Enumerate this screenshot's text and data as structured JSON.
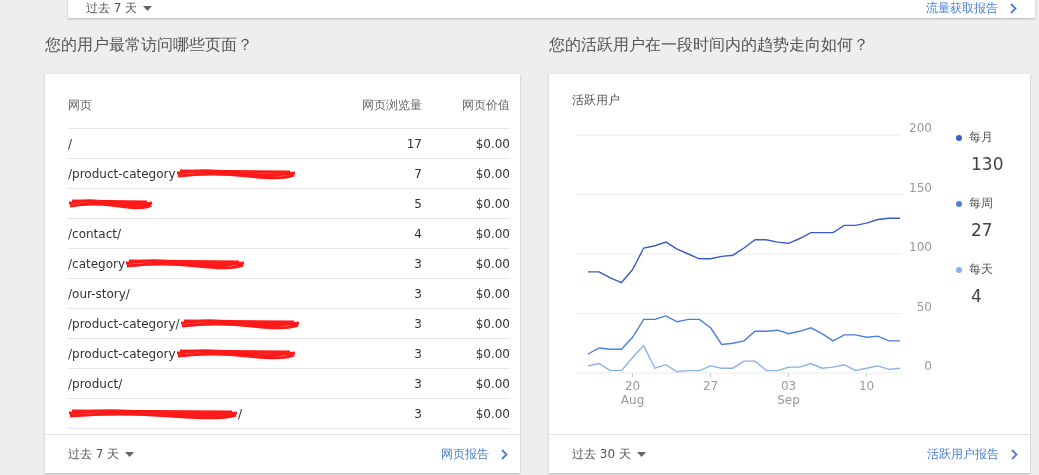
{
  "top_card": {
    "range": "过去 7 天",
    "link": "流量获取报告"
  },
  "pages_section": {
    "title": "您的用户最常访问哪些页面？",
    "columns": [
      "网页",
      "网页浏览量",
      "网页价值"
    ],
    "rows": [
      {
        "page": "/",
        "views": "17",
        "value": "$0.00",
        "redacted": false
      },
      {
        "page": "/product-category",
        "views": "7",
        "value": "$0.00",
        "redacted": true
      },
      {
        "views": "5",
        "value": "$0.00",
        "redacted": true
      },
      {
        "page": "/contact/",
        "views": "4",
        "value": "$0.00",
        "redacted": false
      },
      {
        "page": "/category",
        "views": "3",
        "value": "$0.00",
        "redacted": true
      },
      {
        "page": "/our-story/",
        "views": "3",
        "value": "$0.00",
        "redacted": false
      },
      {
        "page": "/product-category/",
        "views": "3",
        "value": "$0.00",
        "redacted": true
      },
      {
        "page": "/product-category",
        "views": "3",
        "value": "$0.00",
        "redacted": true
      },
      {
        "page": "/product/",
        "views": "3",
        "value": "$0.00",
        "redacted": false
      },
      {
        "page_after": "/",
        "views": "3",
        "value": "$0.00",
        "redacted": true
      }
    ],
    "range": "过去 7 天",
    "link": "网页报告"
  },
  "active_section": {
    "title": "您的活跃用户在一段时间内的趋势走向如何？",
    "card_title": "活跃用户",
    "legend_values": [
      "130",
      "27",
      "4"
    ],
    "chart_data": {
      "type": "line",
      "grid": true,
      "categories": [
        null,
        null,
        null,
        null,
        "20\nAug",
        null,
        null,
        null,
        null,
        null,
        null,
        "27",
        null,
        null,
        null,
        null,
        null,
        null,
        "03\nSep",
        null,
        null,
        null,
        null,
        null,
        null,
        "10",
        null,
        null,
        null
      ],
      "series": [
        {
          "name": "每月",
          "color": "#3b5cc4",
          "values": [
            85,
            85,
            80,
            76,
            87,
            105,
            107,
            110,
            104,
            100,
            96,
            96,
            98,
            99,
            105,
            112,
            112,
            110,
            109,
            113,
            118,
            118,
            118,
            124,
            124,
            126,
            129,
            130,
            130
          ]
        },
        {
          "name": "每周",
          "color": "#4a7fdc",
          "values": [
            16,
            21,
            20,
            20,
            30,
            45,
            45,
            48,
            43,
            45,
            45,
            38,
            24,
            25,
            27,
            35,
            35,
            36,
            33,
            35,
            38,
            33,
            27,
            32,
            32,
            30,
            31,
            27,
            27
          ]
        },
        {
          "name": "每天",
          "color": "#8ab0ee",
          "values": [
            6,
            8,
            2,
            2,
            13,
            23,
            4,
            7,
            1,
            2,
            2,
            6,
            4,
            4,
            10,
            10,
            2,
            2,
            5,
            5,
            8,
            4,
            5,
            7,
            2,
            4,
            6,
            3,
            4
          ]
        }
      ],
      "ylim": [
        0,
        200
      ],
      "yticks": [
        0,
        50,
        100,
        150,
        200
      ]
    },
    "range": "过去 30 天",
    "link": "活跃用户报告"
  }
}
